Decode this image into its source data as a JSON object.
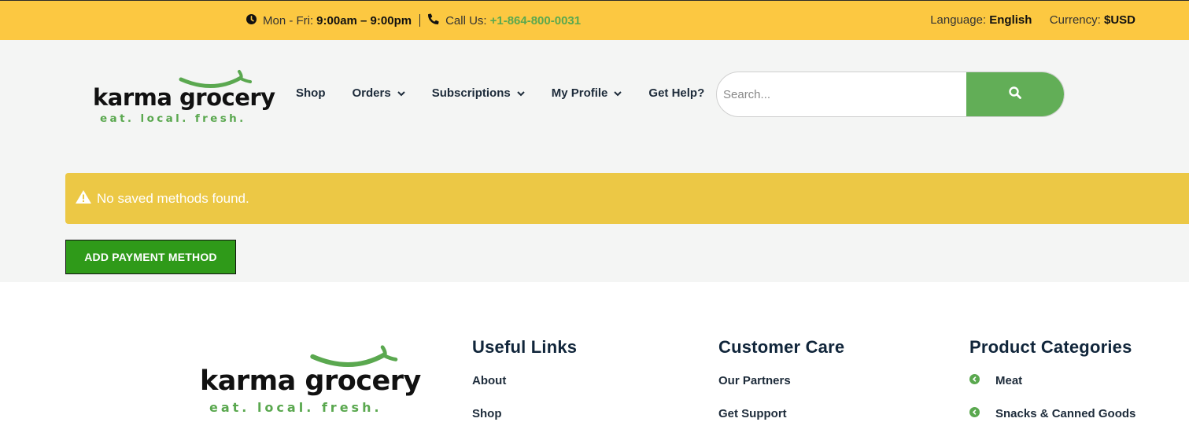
{
  "topbar": {
    "hours_label": "Mon - Fri:",
    "hours_value": "9:00am – 9:00pm",
    "call_label": "Call Us:",
    "phone": "+1-864-800-0031",
    "language_label": "Language:",
    "language_value": "English",
    "currency_label": "Currency:",
    "currency_value": "$USD"
  },
  "logo": {
    "wordmark": "karma grocery",
    "tagline": "eat. local. fresh."
  },
  "nav": {
    "items": [
      {
        "label": "Shop"
      },
      {
        "label": "Orders"
      },
      {
        "label": "Subscriptions"
      },
      {
        "label": "My Profile"
      },
      {
        "label": "Get Help?"
      }
    ]
  },
  "search": {
    "placeholder": "Search...",
    "value": ""
  },
  "notice": {
    "message": "No saved methods found."
  },
  "actions": {
    "add_payment_label": "ADD PAYMENT METHOD"
  },
  "footer": {
    "useful_links": {
      "title": "Useful Links",
      "items": [
        "About",
        "Shop"
      ]
    },
    "customer_care": {
      "title": "Customer Care",
      "items": [
        "Our Partners",
        "Get Support"
      ]
    },
    "product_categories": {
      "title": "Product Categories",
      "items": [
        "Meat",
        "Snacks & Canned Goods"
      ]
    }
  },
  "colors": {
    "topbar_bg": "#fcc841",
    "accent_green": "#62ae57",
    "alert_bg": "#ecc845",
    "button_green": "#2f9a19",
    "header_bg": "#f4f5f4"
  },
  "icons": [
    "clock-icon",
    "phone-icon",
    "chevron-down-icon",
    "search-icon",
    "warning-icon",
    "arrow-circle-left-icon"
  ]
}
